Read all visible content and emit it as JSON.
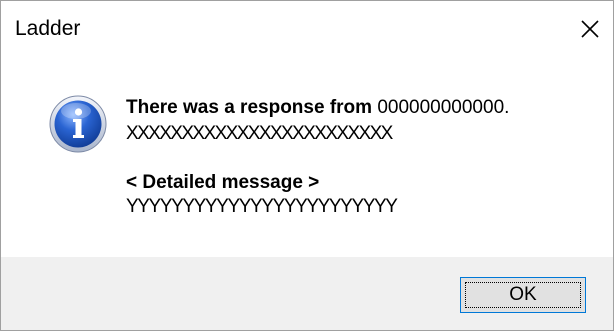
{
  "window": {
    "title": "Ladder"
  },
  "message": {
    "line1_prefix": "There was a response from ",
    "line1_value": "000000000000.",
    "line2": "XXXXXXXXXXXXXXXXXXXXXXXX",
    "detail_heading": "< Detailed message >",
    "detail_text": "YYYYYYYYYYYYYYYYYYYYYYYY"
  },
  "buttons": {
    "ok_label": "OK"
  },
  "icons": {
    "dialog_icon": "information-icon",
    "close": "close-icon"
  },
  "colors": {
    "footer_bg": "#f0f0f0",
    "button_focus_border": "#0078d7",
    "icon_blue": "#1a4fb0"
  }
}
